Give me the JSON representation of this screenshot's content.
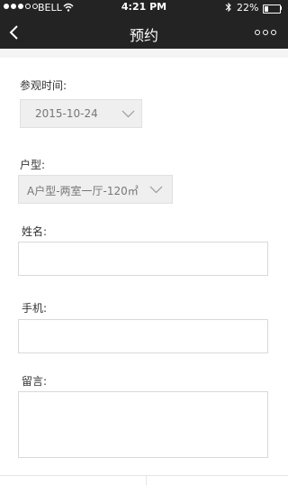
{
  "status_bar": {
    "carrier": "BELL",
    "time": "4:21 PM",
    "battery_percent": "22%",
    "battery_level": 0.22,
    "signal_bars_filled": 3,
    "signal_bars_total": 5
  },
  "nav": {
    "title": "预约",
    "back_icon": "chevron-left-icon",
    "more_icon": "more-dots-icon"
  },
  "form": {
    "visit_time_label": "参观时间:",
    "visit_time_value": "2015-10-24",
    "unit_type_label": "户型:",
    "unit_type_value": "A户型-两室一厅-120㎡",
    "name_label": "姓名:",
    "name_value": "",
    "phone_label": "手机:",
    "phone_value": "",
    "message_label": "留言:",
    "message_value": ""
  },
  "colors": {
    "nav_background": "#232323",
    "page_background": "#ffffff",
    "select_background": "#efefef"
  }
}
